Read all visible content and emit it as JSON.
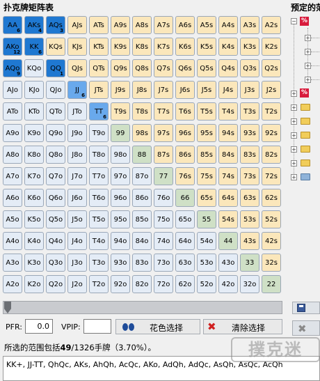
{
  "header": {
    "title": "扑克牌矩阵表",
    "side_title": "预定的范"
  },
  "grid": {
    "rows": [
      [
        "AA",
        "AKs",
        "AQs",
        "AJs",
        "ATs",
        "A9s",
        "A8s",
        "A7s",
        "A6s",
        "A5s",
        "A4s",
        "A3s",
        "A2s"
      ],
      [
        "AKo",
        "KK",
        "KQs",
        "KJs",
        "KTs",
        "K9s",
        "K8s",
        "K7s",
        "K6s",
        "K5s",
        "K4s",
        "K3s",
        "K2s"
      ],
      [
        "AQo",
        "KQo",
        "QQ",
        "QJs",
        "QTs",
        "Q9s",
        "Q8s",
        "Q7s",
        "Q6s",
        "Q5s",
        "Q4s",
        "Q3s",
        "Q2s"
      ],
      [
        "AJo",
        "KJo",
        "QJo",
        "JJ",
        "JTs",
        "J9s",
        "J8s",
        "J7s",
        "J6s",
        "J5s",
        "J4s",
        "J3s",
        "J2s"
      ],
      [
        "ATo",
        "KTo",
        "QTo",
        "JTo",
        "TT",
        "T9s",
        "T8s",
        "T7s",
        "T6s",
        "T5s",
        "T4s",
        "T3s",
        "T2s"
      ],
      [
        "A9o",
        "K9o",
        "Q9o",
        "J9o",
        "T9o",
        "99",
        "98s",
        "97s",
        "96s",
        "95s",
        "94s",
        "93s",
        "92s"
      ],
      [
        "A8o",
        "K8o",
        "Q8o",
        "J8o",
        "T8o",
        "98o",
        "88",
        "87s",
        "86s",
        "85s",
        "84s",
        "83s",
        "82s"
      ],
      [
        "A7o",
        "K7o",
        "Q7o",
        "J7o",
        "T7o",
        "97o",
        "87o",
        "77",
        "76s",
        "75s",
        "74s",
        "73s",
        "72s"
      ],
      [
        "A6o",
        "K6o",
        "Q6o",
        "J6o",
        "T6o",
        "96o",
        "86o",
        "76o",
        "66",
        "65s",
        "64s",
        "63s",
        "62s"
      ],
      [
        "A5o",
        "K5o",
        "Q5o",
        "J5o",
        "T5o",
        "95o",
        "85o",
        "75o",
        "65o",
        "55",
        "54s",
        "53s",
        "52s"
      ],
      [
        "A4o",
        "K4o",
        "Q4o",
        "J4o",
        "T4o",
        "94o",
        "84o",
        "74o",
        "64o",
        "54o",
        "44",
        "43s",
        "42s"
      ],
      [
        "A3o",
        "K3o",
        "Q3o",
        "J3o",
        "T3o",
        "93o",
        "83o",
        "73o",
        "63o",
        "53o",
        "43o",
        "33",
        "32s"
      ],
      [
        "A2o",
        "K2o",
        "Q2o",
        "J2o",
        "T2o",
        "92o",
        "82o",
        "72o",
        "62o",
        "52o",
        "42o",
        "32o",
        "22"
      ]
    ],
    "selected": {
      "AA": {
        "combos": "6",
        "shade": "dark"
      },
      "AKs": {
        "combos": "4",
        "shade": "dark"
      },
      "AQs": {
        "combos": "3",
        "shade": "dark"
      },
      "AKo": {
        "combos": "12",
        "shade": "dark"
      },
      "KK": {
        "combos": "6",
        "shade": "dark"
      },
      "AQo": {
        "combos": "9",
        "shade": "dark"
      },
      "QQ": {
        "combos": "1",
        "shade": "dark"
      },
      "JJ": {
        "combos": "6",
        "shade": "light"
      },
      "TT": {
        "combos": "6",
        "shade": "light"
      }
    },
    "colors": {
      "suited": "#fbe7bb",
      "offsuit": "#e4ecf6",
      "pair": "#cfe0c6",
      "selected_dark": "#1f78d1",
      "selected_light": "#69a9ec"
    }
  },
  "controls": {
    "pfr_label": "PFR:",
    "pfr_value": "0.0",
    "vpip_label": "VPIP:",
    "vpip_value": "",
    "suit_select_label": "花色选择",
    "clear_label": "清除选择"
  },
  "summary": {
    "prefix": "所选的范围包括",
    "combos": "49",
    "total": "/1326手牌",
    "percent": "（3.70%）。"
  },
  "range_text": "KK+, JJ-TT, QhQc, AKs, AhQh, AcQc, AKo, AdQh, AdQc, AsQh, AsQc, AcQh",
  "watermark": "撲克迷",
  "icons": [
    "pct-icon",
    "folder-icon",
    "expand-icon",
    "save-icon",
    "slider-thumb-icon",
    "suit-icon",
    "clear-x-icon"
  ]
}
